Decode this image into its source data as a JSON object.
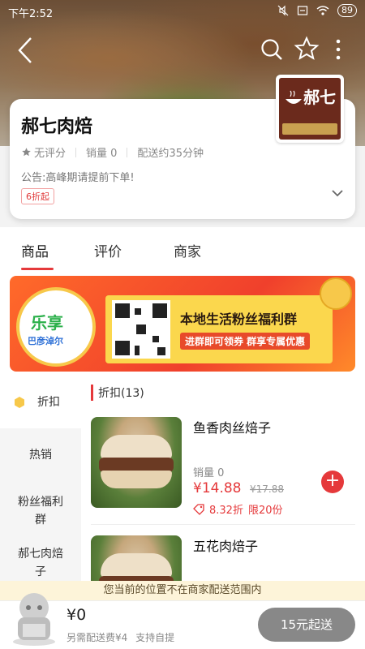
{
  "statusbar": {
    "time": "下午2:52",
    "battery": "89"
  },
  "shop": {
    "name": "郝七肉焙",
    "logo_text": "郝七",
    "rating_label": "无评分",
    "sales_label": "销量 0",
    "delivery_label": "配送约35分钟",
    "notice": "公告:高峰期请提前下单!",
    "discount_tag": "6折起"
  },
  "tabs": [
    {
      "label": "商品"
    },
    {
      "label": "评价"
    },
    {
      "label": "商家"
    }
  ],
  "banner": {
    "brand_cn": "乐享",
    "brand_sub": "巴彦淖尔",
    "line1": "本地生活粉丝福利群",
    "line2": "进群即可领券 群享专属优惠"
  },
  "sidebar": {
    "items": [
      {
        "label": "折扣"
      },
      {
        "label": "热销"
      },
      {
        "label": "粉丝福利群"
      },
      {
        "label": "郝七肉焙子"
      }
    ]
  },
  "section": {
    "title": "折扣(13)"
  },
  "products": [
    {
      "name": "鱼香肉丝焙子",
      "sold": "销量 0",
      "price": "¥14.88",
      "orig_price": "¥17.88",
      "discount": "8.32折",
      "limit": "限20份"
    },
    {
      "name": "五花肉焙子"
    }
  ],
  "range_notice": "您当前的位置不在商家配送范围内",
  "cart": {
    "total": "¥0",
    "delivery_fee": "另需配送费¥4",
    "pickup": "支持自提",
    "checkout_label": "15元起送"
  },
  "colors": {
    "accent": "#e5393b",
    "checkout_bg": "#888888"
  }
}
